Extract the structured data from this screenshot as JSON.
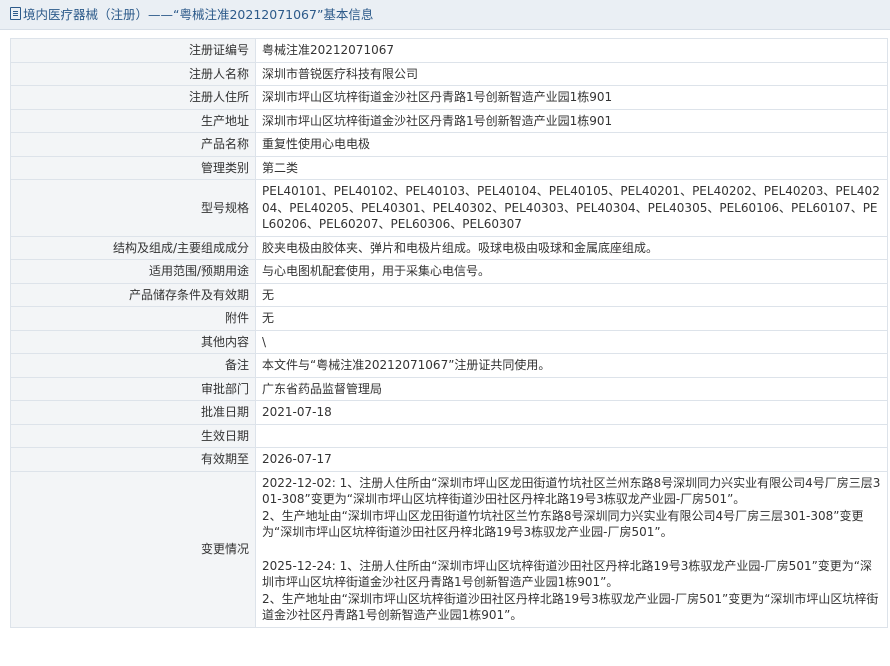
{
  "header": {
    "title": "境内医疗器械（注册）——“粤械注准20212071067”基本信息"
  },
  "rows": [
    {
      "label": "注册证编号",
      "value": "粤械注准20212071067"
    },
    {
      "label": "注册人名称",
      "value": "深圳市普锐医疗科技有限公司"
    },
    {
      "label": "注册人住所",
      "value": "深圳市坪山区坑梓街道金沙社区丹青路1号创新智造产业园1栋901"
    },
    {
      "label": "生产地址",
      "value": "深圳市坪山区坑梓街道金沙社区丹青路1号创新智造产业园1栋901"
    },
    {
      "label": "产品名称",
      "value": "重复性使用心电电极"
    },
    {
      "label": "管理类别",
      "value": "第二类"
    },
    {
      "label": "型号规格",
      "value": "PEL40101、PEL40102、PEL40103、PEL40104、PEL40105、PEL40201、PEL40202、PEL40203、PEL40204、PEL40205、PEL40301、PEL40302、PEL40303、PEL40304、PEL40305、PEL60106、PEL60107、PEL60206、PEL60207、PEL60306、PEL60307"
    },
    {
      "label": "结构及组成/主要组成成分",
      "value": "胶夹电极由胶体夹、弹片和电极片组成。吸球电极由吸球和金属底座组成。"
    },
    {
      "label": "适用范围/预期用途",
      "value": "与心电图机配套使用，用于采集心电信号。"
    },
    {
      "label": "产品储存条件及有效期",
      "value": "无"
    },
    {
      "label": "附件",
      "value": "无"
    },
    {
      "label": "其他内容",
      "value": "\\"
    },
    {
      "label": "备注",
      "value": "本文件与“粤械注准20212071067”注册证共同使用。"
    },
    {
      "label": "审批部门",
      "value": "广东省药品监督管理局"
    },
    {
      "label": "批准日期",
      "value": "2021-07-18"
    },
    {
      "label": "生效日期",
      "value": ""
    },
    {
      "label": "有效期至",
      "value": "2026-07-17"
    }
  ],
  "changes": {
    "label": "变更情况",
    "lines": [
      "2022-12-02: 1、注册人住所由“深圳市坪山区龙田街道竹坑社区兰州东路8号深圳同力兴实业有限公司4号厂房三层301-308”变更为“深圳市坪山区坑梓街道沙田社区丹梓北路19号3栋驭龙产业园-厂房501”。",
      "2、生产地址由“深圳市坪山区龙田街道竹坑社区兰竹东路8号深圳同力兴实业有限公司4号厂房三层301-308”变更为“深圳市坪山区坑梓街道沙田社区丹梓北路19号3栋驭龙产业园-厂房501”。",
      "",
      "2025-12-24: 1、注册人住所由“深圳市坪山区坑梓街道沙田社区丹梓北路19号3栋驭龙产业园-厂房501”变更为“深圳市坪山区坑梓街道金沙社区丹青路1号创新智造产业园1栋901”。",
      "2、生产地址由“深圳市坪山区坑梓街道沙田社区丹梓北路19号3栋驭龙产业园-厂房501”变更为“深圳市坪山区坑梓街道金沙社区丹青路1号创新智造产业园1栋901”。"
    ]
  }
}
